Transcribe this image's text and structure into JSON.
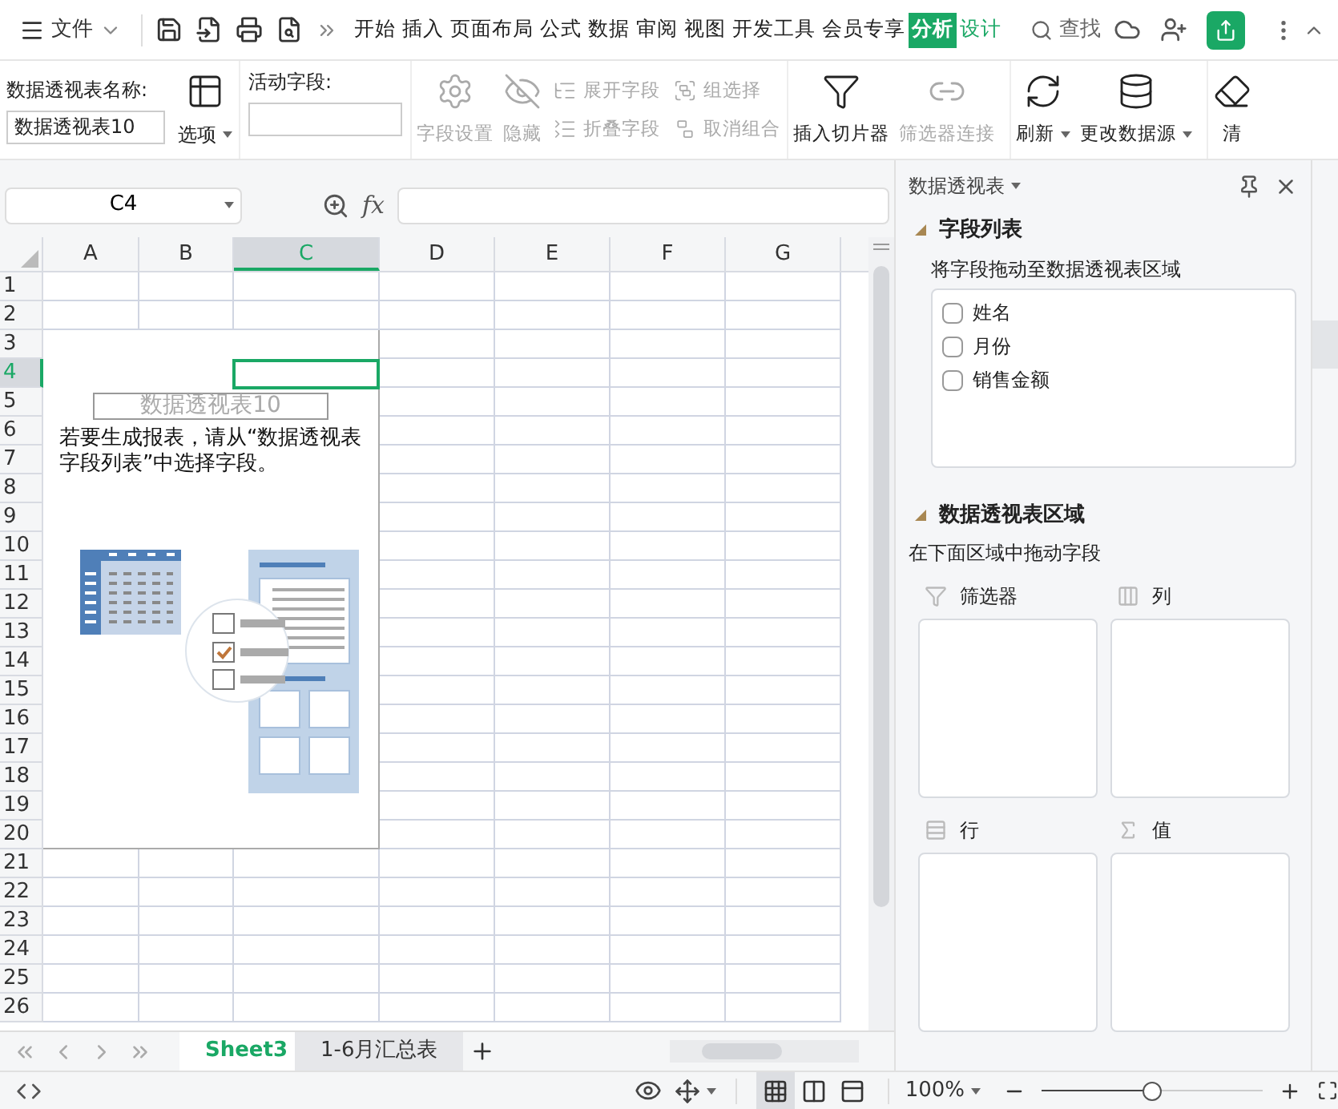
{
  "menu": {
    "label": "文件"
  },
  "tabs": [
    {
      "label": "开始",
      "selected": false,
      "contextual": false
    },
    {
      "label": "插入",
      "selected": false,
      "contextual": false
    },
    {
      "label": "页面布局",
      "selected": false,
      "contextual": false
    },
    {
      "label": "公式",
      "selected": false,
      "contextual": false
    },
    {
      "label": "数据",
      "selected": false,
      "contextual": false
    },
    {
      "label": "审阅",
      "selected": false,
      "contextual": false
    },
    {
      "label": "视图",
      "selected": false,
      "contextual": false
    },
    {
      "label": "开发工具",
      "selected": false,
      "contextual": false
    },
    {
      "label": "会员专享",
      "selected": false,
      "contextual": false
    },
    {
      "label": "分析",
      "selected": true,
      "contextual": true
    },
    {
      "label": "设计",
      "selected": false,
      "contextual": true
    }
  ],
  "search": {
    "label": "查找"
  },
  "ribbon": {
    "name_label": "数据透视表名称:",
    "name_value": "数据透视表10",
    "options": "选项",
    "active_field_label": "活动字段:",
    "buttons": [
      {
        "kind": "big",
        "label": "字段设置",
        "disabled": true,
        "caret": false
      },
      {
        "kind": "big",
        "label": "隐藏",
        "disabled": true,
        "caret": false
      },
      {
        "kind": "pair",
        "items": [
          {
            "label": "展开字段",
            "disabled": true
          },
          {
            "label": "折叠字段",
            "disabled": true
          }
        ]
      },
      {
        "kind": "pair",
        "items": [
          {
            "label": "组选择",
            "disabled": true
          },
          {
            "label": "取消组合",
            "disabled": true
          }
        ]
      },
      {
        "kind": "big",
        "label": "插入切片器",
        "disabled": false,
        "caret": false
      },
      {
        "kind": "big",
        "label": "筛选器连接",
        "disabled": true,
        "caret": false
      },
      {
        "kind": "big",
        "label": "刷新",
        "disabled": false,
        "caret": true
      },
      {
        "kind": "big",
        "label": "更改数据源",
        "disabled": false,
        "caret": true
      },
      {
        "kind": "big",
        "label": "清",
        "disabled": false,
        "caret": false
      }
    ]
  },
  "name_box": {
    "value": "C4"
  },
  "formula_bar": {
    "fx": "fx"
  },
  "columns": [
    {
      "label": "A",
      "selected": false
    },
    {
      "label": "B",
      "selected": false
    },
    {
      "label": "C",
      "selected": true
    },
    {
      "label": "D",
      "selected": false
    },
    {
      "label": "E",
      "selected": false
    },
    {
      "label": "F",
      "selected": false
    },
    {
      "label": "G",
      "selected": false
    }
  ],
  "rows": [
    {
      "label": "1",
      "selected": false
    },
    {
      "label": "2",
      "selected": false
    },
    {
      "label": "3",
      "selected": false
    },
    {
      "label": "4",
      "selected": true
    },
    {
      "label": "5",
      "selected": false
    },
    {
      "label": "6",
      "selected": false
    },
    {
      "label": "7",
      "selected": false
    },
    {
      "label": "8",
      "selected": false
    },
    {
      "label": "9",
      "selected": false
    },
    {
      "label": "10",
      "selected": false
    },
    {
      "label": "11",
      "selected": false
    },
    {
      "label": "12",
      "selected": false
    },
    {
      "label": "13",
      "selected": false
    },
    {
      "label": "14",
      "selected": false
    },
    {
      "label": "15",
      "selected": false
    },
    {
      "label": "16",
      "selected": false
    },
    {
      "label": "17",
      "selected": false
    },
    {
      "label": "18",
      "selected": false
    },
    {
      "label": "19",
      "selected": false
    },
    {
      "label": "20",
      "selected": false
    },
    {
      "label": "21",
      "selected": false
    },
    {
      "label": "22",
      "selected": false
    },
    {
      "label": "23",
      "selected": false
    },
    {
      "label": "24",
      "selected": false
    },
    {
      "label": "25",
      "selected": false
    },
    {
      "label": "26",
      "selected": false
    }
  ],
  "pivot_placeholder": {
    "title": "数据透视表10",
    "message": "若要生成报表，请从“数据透视表字段列表”中选择字段。"
  },
  "sidebar": {
    "title": "数据透视表",
    "field_section": {
      "title": "字段列表",
      "hint": "将字段拖动至数据透视表区域",
      "fields": [
        {
          "label": "姓名",
          "checked": false
        },
        {
          "label": "月份",
          "checked": false
        },
        {
          "label": "销售金额",
          "checked": false
        }
      ]
    },
    "area_section": {
      "title": "数据透视表区域",
      "hint": "在下面区域中拖动字段",
      "areas": [
        {
          "kind": "filter",
          "label": "筛选器"
        },
        {
          "kind": "columns",
          "label": "列"
        },
        {
          "kind": "rows",
          "label": "行"
        },
        {
          "kind": "values",
          "label": "值"
        }
      ]
    }
  },
  "sheet_tabs": [
    {
      "label": "Sheet3",
      "selected": true
    },
    {
      "label": "1-6月汇总表",
      "selected": false
    }
  ],
  "status_bar": {
    "views": [
      {
        "kind": "normal",
        "selected": true
      },
      {
        "kind": "page",
        "selected": false
      },
      {
        "kind": "break",
        "selected": false
      }
    ],
    "zoom": "100%",
    "zoom_slider": {
      "level": 0.5
    }
  }
}
